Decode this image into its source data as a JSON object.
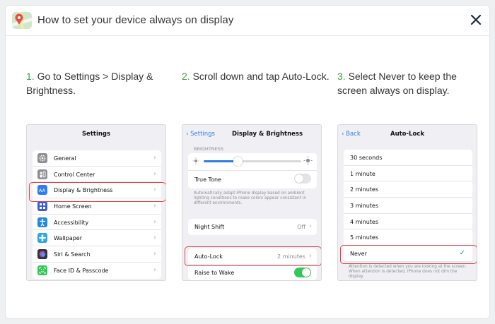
{
  "dialog": {
    "title": "How to set your device always on display",
    "app_icon": "maps-app-icon",
    "close_icon": "close-icon"
  },
  "steps": [
    {
      "num": "1.",
      "text": " Go to Settings > Display & Brightness."
    },
    {
      "num": "2.",
      "text": " Scroll down and tap Auto-Lock."
    },
    {
      "num": "3.",
      "text": " Select Never to keep the screen always on display."
    }
  ],
  "colors": {
    "step_number": "#3aa63a",
    "highlight": "#e0424a",
    "ios_blue": "#2a7ee0",
    "ios_green": "#34c759"
  },
  "screen1": {
    "title": "Settings",
    "items": [
      {
        "label": "General",
        "icon": "gear-icon",
        "color": "#8e8e93"
      },
      {
        "label": "Control Center",
        "icon": "control-center-icon",
        "color": "#8e8e93"
      },
      {
        "label": "Display & Brightness",
        "icon": "display-icon",
        "color": "#2f7cf6"
      },
      {
        "label": "Home Screen",
        "icon": "home-screen-icon",
        "color": "#3b5bdb"
      },
      {
        "label": "Accessibility",
        "icon": "accessibility-icon",
        "color": "#1e88e5"
      },
      {
        "label": "Wallpaper",
        "icon": "wallpaper-icon",
        "color": "#29a9e0"
      },
      {
        "label": "Siri & Search",
        "icon": "siri-icon",
        "color": "#333333"
      },
      {
        "label": "Face ID & Passcode",
        "icon": "face-id-icon",
        "color": "#34c759"
      }
    ]
  },
  "screen2": {
    "back": "Settings",
    "title": "Display & Brightness",
    "section": "BRIGHTNESS",
    "brightness_level": 0.35,
    "true_tone": {
      "label": "True Tone",
      "on": false
    },
    "true_tone_note": "Automatically adapt iPhone display based on ambient lighting conditions to make colors appear consistent in different environments.",
    "night_shift": {
      "label": "Night Shift",
      "value": "Off"
    },
    "auto_lock": {
      "label": "Auto-Lock",
      "value": "2 minutes"
    },
    "raise_to_wake": {
      "label": "Raise to Wake",
      "on": true
    }
  },
  "screen3": {
    "back": "Back",
    "title": "Auto-Lock",
    "options": [
      "30 seconds",
      "1 minute",
      "2 minutes",
      "3 minutes",
      "4 minutes",
      "5 minutes"
    ],
    "selected": "Never",
    "note": "Attention is detected when you are looking at the screen. When attention is detected, iPhone does not dim the display."
  }
}
